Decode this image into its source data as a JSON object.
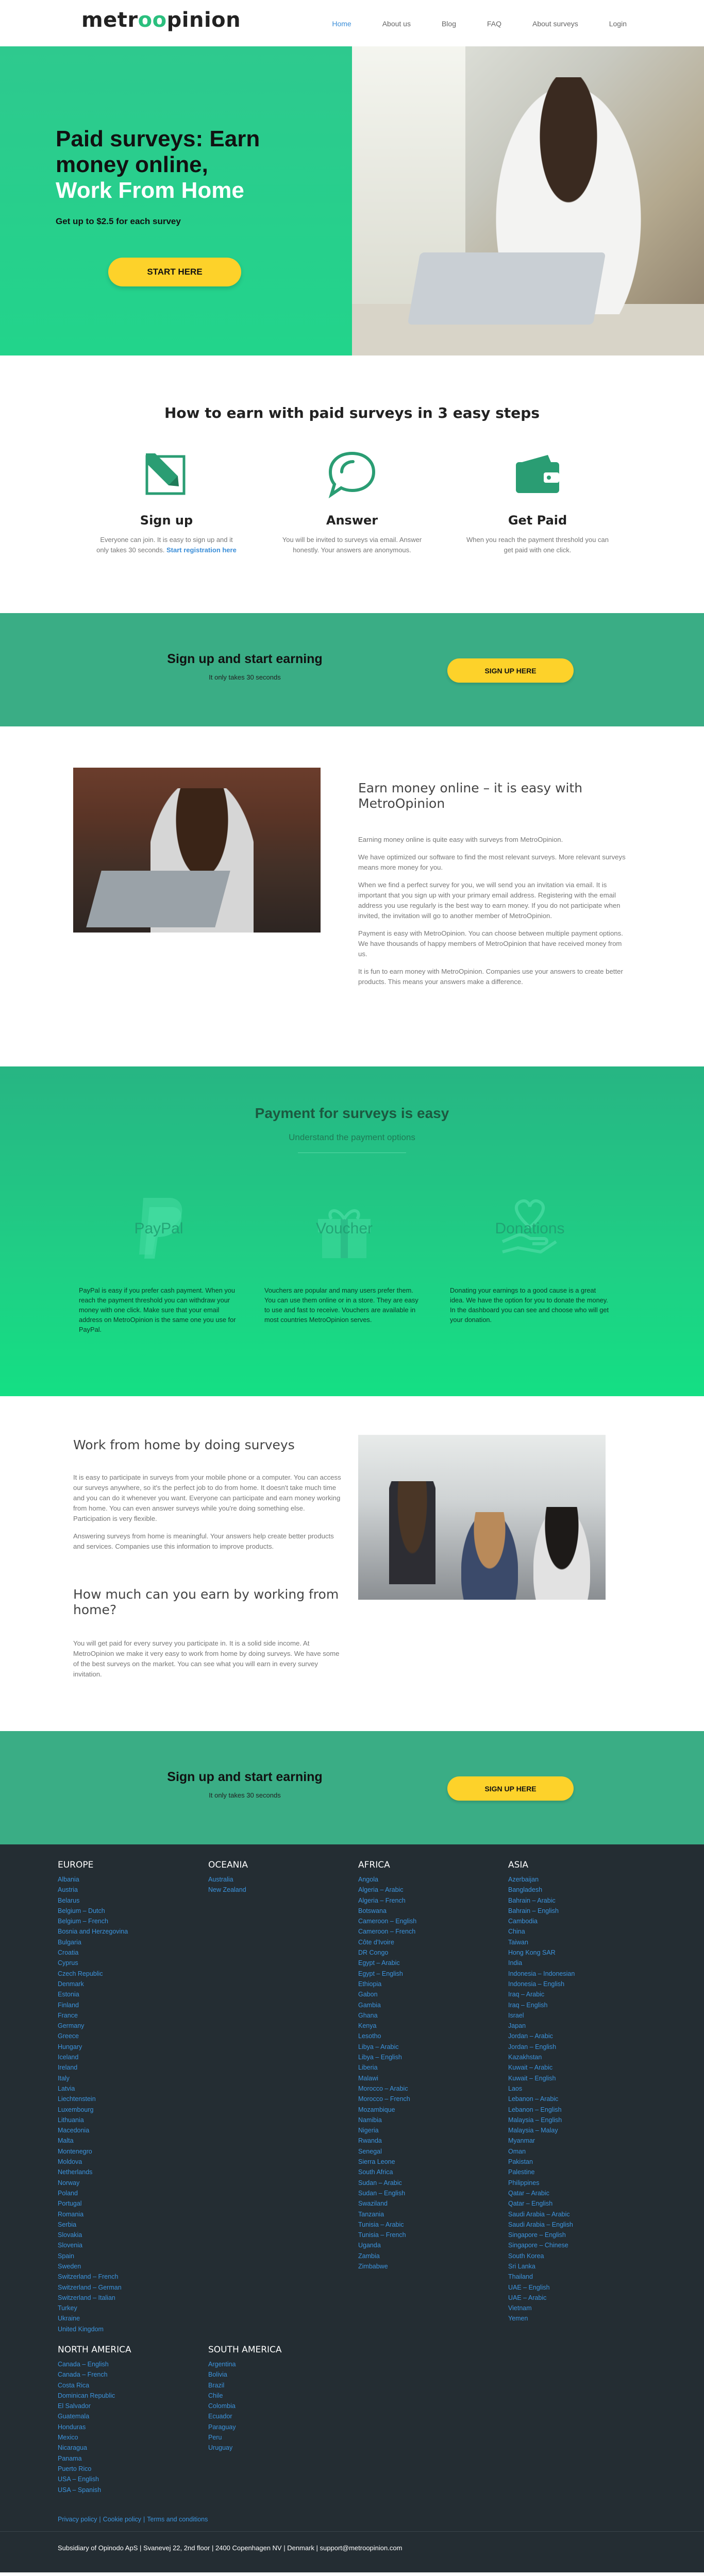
{
  "header": {
    "logo_pre": "metr",
    "logo_oo": "oo",
    "logo_post": "pinion",
    "nav": [
      "Home",
      "About us",
      "Blog",
      "FAQ",
      "About surveys",
      "Login"
    ],
    "active": "Home"
  },
  "hero": {
    "title_line1": "Paid surveys: Earn",
    "title_line2": "money online,",
    "title_line3": "Work From Home",
    "subtitle": "Get up to $2.5 for each survey",
    "cta": "START HERE"
  },
  "steps": {
    "title": "How to earn with paid surveys in 3 easy steps",
    "items": [
      {
        "title": "Sign up",
        "text": "Everyone can join. It is easy to sign up and it only takes 30 seconds.",
        "link": "Start registration here"
      },
      {
        "title": "Answer",
        "text": "You will be invited to surveys via email. Answer honestly. Your answers are anonymous."
      },
      {
        "title": "Get Paid",
        "text": "When you reach the payment threshold you can get paid with one click."
      }
    ]
  },
  "band": {
    "title": "Sign up and start earning",
    "small": "It only takes 30 seconds",
    "button": "SIGN UP HERE"
  },
  "earn": {
    "title": "Earn money online – it is easy with MetroOpinion",
    "paragraphs": [
      "Earning money online is quite easy with surveys from MetroOpinion.",
      "We have optimized our software to find the most relevant surveys. More relevant surveys means more money for you.",
      "When we find a perfect survey for you, we will send you an invitation via email. It is important that you sign up with your primary email address. Registering with the email address you use regularly is the best way to earn money. If you do not participate when invited, the invitation will go to another member of MetroOpinion.",
      "Payment is easy with MetroOpinion. You can choose between multiple payment options. We have thousands of happy members of MetroOpinion that have received money from us.",
      "It is fun to earn money with MetroOpinion. Companies use your answers to create better products. This means your answers make a difference."
    ]
  },
  "payment": {
    "title": "Payment for surveys is easy",
    "subtitle": "Understand the payment options",
    "options": [
      {
        "label": "PayPal",
        "text": "PayPal is easy if you prefer cash payment. When you reach the payment threshold you can withdraw your money with one click. Make sure that your email address on MetroOpinion is the same one you use for PayPal."
      },
      {
        "label": "Voucher",
        "text": "Vouchers are popular and many users prefer them. You can use them online or in a store. They are easy to use and fast to receive. Vouchers are available in most countries MetroOpinion serves."
      },
      {
        "label": "Donations",
        "text": "Donating your earnings to a good cause is a great idea. We have the option for you to donate the money. In the dashboard you can see and choose who will get your donation."
      }
    ]
  },
  "wfh": {
    "title1": "Work from home by doing surveys",
    "paragraphs1": [
      "It is easy to participate in surveys from your mobile phone or a computer. You can access our surveys anywhere, so it's the perfect job to do from home. It doesn't take much time and you can do it whenever you want. Everyone can participate and earn money working from home. You can even answer surveys while you're doing something else. Participation is very flexible.",
      "Answering surveys from home is meaningful. Your answers help create better products and services. Companies use this information to improve products."
    ],
    "title2": "How much can you earn by working from home?",
    "paragraphs2": [
      "You will get paid for every survey you participate in. It is a solid side income. At MetroOpinion we make it very easy to work from home by doing surveys. We have some of the best surveys on the market. You can see what you will earn in every survey invitation."
    ]
  },
  "band2": {
    "title": "Sign up and start earning",
    "small": "It only takes 30 seconds",
    "button": "SIGN UP HERE"
  },
  "footer": {
    "europe": {
      "title": "EUROPE",
      "items": [
        "Albania",
        "Austria",
        "Belarus",
        "Belgium – Dutch",
        "Belgium – French",
        "Bosnia and Herzegovina",
        "Bulgaria",
        "Croatia",
        "Cyprus",
        "Czech Republic",
        "Denmark",
        "Estonia",
        "Finland",
        "France",
        "Germany",
        "Greece",
        "Hungary",
        "Iceland",
        "Ireland",
        "Italy",
        "Latvia",
        "Liechtenstein",
        "Luxembourg",
        "Lithuania",
        "Macedonia",
        "Malta",
        "Montenegro",
        "Moldova",
        "Netherlands",
        "Norway",
        "Poland",
        "Portugal",
        "Romania",
        "Serbia",
        "Slovakia",
        "Slovenia",
        "Spain",
        "Sweden",
        "Switzerland – French",
        "Switzerland – German",
        "Switzerland – Italian",
        "Turkey",
        "Ukraine",
        "United Kingdom"
      ]
    },
    "oceania": {
      "title": "OCEANIA",
      "items": [
        "Australia",
        "New Zealand"
      ]
    },
    "africa": {
      "title": "AFRICA",
      "items": [
        "Angola",
        "Algeria – Arabic",
        "Algeria – French",
        "Botswana",
        "Cameroon – English",
        "Cameroon – French",
        "Côte d'Ivoire",
        "DR Congo",
        "Egypt – Arabic",
        "Egypt – English",
        "Ethiopia",
        "Gabon",
        "Gambia",
        "Ghana",
        "Kenya",
        "Lesotho",
        "Libya – Arabic",
        "Libya – English",
        "Liberia",
        "Malawi",
        "Morocco – Arabic",
        "Morocco – French",
        "Mozambique",
        "Namibia",
        "Nigeria",
        "Rwanda",
        "Senegal",
        "Sierra Leone",
        "South Africa",
        "Sudan – Arabic",
        "Sudan – English",
        "Swaziland",
        "Tanzania",
        "Tunisia – Arabic",
        "Tunisia – French",
        "Uganda",
        "Zambia",
        "Zimbabwe"
      ]
    },
    "asia": {
      "title": "ASIA",
      "items": [
        "Azerbaijan",
        "Bangladesh",
        "Bahrain – Arabic",
        "Bahrain – English",
        "Cambodia",
        "China",
        "Taiwan",
        "Hong Kong SAR",
        "India",
        "Indonesia – Indonesian",
        "Indonesia – English",
        "Iraq – Arabic",
        "Iraq – English",
        "Israel",
        "Japan",
        "Jordan – Arabic",
        "Jordan – English",
        "Kazakhstan",
        "Kuwait – Arabic",
        "Kuwait – English",
        "Laos",
        "Lebanon – Arabic",
        "Lebanon – English",
        "Malaysia – English",
        "Malaysia – Malay",
        "Myanmar",
        "Oman",
        "Pakistan",
        "Palestine",
        "Philippines",
        "Qatar – Arabic",
        "Qatar – English",
        "Saudi Arabia – Arabic",
        "Saudi Arabia – English",
        "Singapore – English",
        "Singapore – Chinese",
        "South Korea",
        "Sri Lanka",
        "Thailand",
        "UAE – English",
        "UAE – Arabic",
        "Vietnam",
        "Yemen"
      ]
    },
    "north_america": {
      "title": "NORTH AMERICA",
      "items": [
        "Canada – English",
        "Canada – French",
        "Costa Rica",
        "Dominican Republic",
        "El Salvador",
        "Guatemala",
        "Honduras",
        "Mexico",
        "Nicaragua",
        "Panama",
        "Puerto Rico",
        "USA – English",
        "USA – Spanish"
      ]
    },
    "south_america": {
      "title": "SOUTH AMERICA",
      "items": [
        "Argentina",
        "Bolivia",
        "Brazil",
        "Chile",
        "Colombia",
        "Ecuador",
        "Paraguay",
        "Peru",
        "Uruguay"
      ]
    },
    "links": [
      "Privacy policy",
      "Cookie policy",
      "Terms and conditions"
    ],
    "address": "Subsidiary of Opinodo ApS | Svanevej 22, 2nd floor | 2400 Copenhagen NV | Denmark | support@metroopinion.com"
  }
}
